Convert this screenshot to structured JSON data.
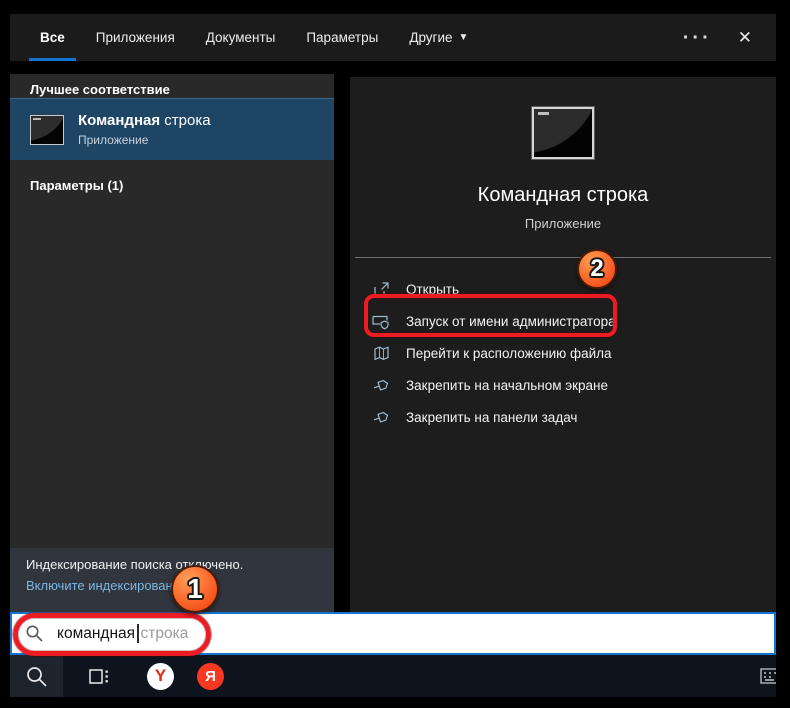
{
  "window": {
    "more_glyph": "···",
    "close_glyph": "✕",
    "dropdown_glyph": "▼"
  },
  "tabs": [
    {
      "label": "Все",
      "active": true
    },
    {
      "label": "Приложения",
      "active": false
    },
    {
      "label": "Документы",
      "active": false
    },
    {
      "label": "Параметры",
      "active": false
    },
    {
      "label": "Другие",
      "active": false,
      "has_dropdown": true
    }
  ],
  "left_panel": {
    "best_match_header": "Лучшее соответствие",
    "best_match": {
      "title_bold": "Командная",
      "title_rest": "строка",
      "subtitle": "Приложение"
    },
    "params_header": "Параметры (1)",
    "status_text": "Индексирование поиска отключено.",
    "status_link": "Включите индексирование..."
  },
  "preview": {
    "title": "Командная строка",
    "subtitle": "Приложение",
    "actions": [
      {
        "label": "Открыть",
        "icon": "open-icon"
      },
      {
        "label": "Запуск от имени администратора",
        "icon": "admin-shield-icon",
        "highlighted": true
      },
      {
        "label": "Перейти к расположению файла",
        "icon": "file-location-icon"
      },
      {
        "label": "Закрепить на начальном экране",
        "icon": "pin-icon"
      },
      {
        "label": "Закрепить на панели задач",
        "icon": "pin-icon"
      }
    ]
  },
  "search": {
    "typed": "командная",
    "suggestion": "строка"
  },
  "annotations": {
    "step1": "1",
    "step2": "2"
  },
  "taskbar": {
    "icons": [
      "search-icon",
      "task-view-icon",
      "yandex-browser-icon",
      "yandex-icon",
      "keyboard-icon"
    ],
    "yandex_browser_letter": "Y",
    "yandex_letter": "Я"
  },
  "colors": {
    "annotation_red": "#ec1c24",
    "badge_orange": "#fb6a2c",
    "selection_blue": "#1f4565",
    "tab_underline": "#1573cf",
    "search_border": "#1474cf",
    "link_blue": "#79b7e0"
  }
}
